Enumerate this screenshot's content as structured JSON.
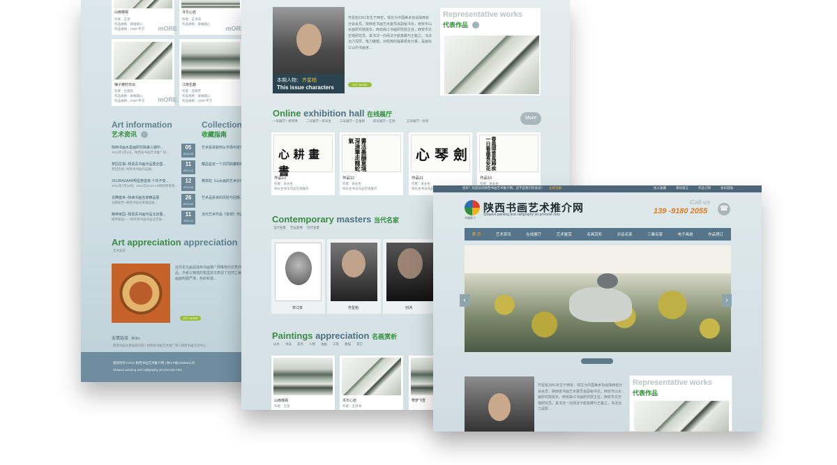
{
  "left_panel": {
    "thumbs": [
      {
        "title": "山雨楼阁",
        "line1": "作者：王觉",
        "line2": "作品规格：屏幅镜心",
        "line3": "作品规格：1000*平方"
      },
      {
        "title": "寻华心岩",
        "line1": "作者：王洪涛",
        "line2": "作品规格：屏幅镜心",
        "line3": "作品规格：1000*平方"
      },
      {
        "title": "梅子黄时日出",
        "line1": "作者：吕基智",
        "line2": "作品规格：屏幅镜心",
        "line3": "作品规格：1000*平方"
      },
      {
        "title": "江南生趣",
        "line1": "作者：吕晓芳",
        "line2": "作品规格：屏幅镜心",
        "line3": "作品规格：1000*平方"
      }
    ],
    "more_label": "mORE",
    "art_info": {
      "title_en": "Art information",
      "title_cn": "艺术资讯",
      "items": [
        {
          "text": "陕西书画水墨画研究院第三期中...",
          "sub": "2014年3月1日，陕西省书画艺术推广研...",
          "day": "05",
          "ym": "2014.03"
        },
        {
          "text": "梦回见相--杨贤青书画作品展全国...",
          "sub": "梦回见相--杨贤青书画作品展...",
          "day": "11",
          "ym": "2013.10"
        },
        {
          "text": "2012BAZAAR明星慈善夜 十年不变...",
          "sub": "2012年7月30日，2012年BAZAAR明星慈善夜...",
          "day": "12",
          "ym": "2012.06"
        },
        {
          "text": "龙腾盛世--陕西书画名家精品展",
          "sub": "龙腾盛世--陕西书画名家精品展...",
          "day": "26",
          "ym": "2012.02"
        },
        {
          "text": "精神家园--杨贤青书画作品北京展...",
          "sub": "精神家园——杨贤青书画作品北京展...",
          "day": "11",
          "ym": "2011.11"
        }
      ]
    },
    "collection": {
      "title_en": "Collection",
      "title_cn": "收藏指南",
      "items": [
        "艺术投资如何从市场中定位...",
        "藏品鉴定一个共同收藏和判断...",
        "黄宾虹《山水画的艺术价值》...",
        "艺术品投资的风险与回报...",
        "当代艺术作品《吉祥》作品赏析"
      ]
    },
    "art_app": {
      "title_en": "Art appreciation",
      "title_en2": "appreciation",
      "title_cn": "艺术鉴赏",
      "para": "这件花鸟画是陕西书画推广网推荐的优秀作品，作者以精湛的笔墨技法表现了自然之美，画面构图严谨，色彩和谐...",
      "btn": "GET MORE"
    },
    "links": {
      "title": "友情链接",
      "title_en": "links"
    },
    "footer_links": "陕西书画水墨画研究院 | 陕西省书画艺术推广网 | 陕西书画交流中心",
    "footer1": "版权所有©2013 陕西书画艺术推介网 | 陕ICP备10006011号",
    "footer2": "Shaanxi painting and calligraphy art promote nets"
  },
  "middle_panel": {
    "issue": {
      "label": "本期人物：",
      "name": "齐星柏",
      "en": "This issue characters",
      "btn": "GET MORE",
      "para": "齐星柏1951年生于西安，现在为中国美术协会陕西省分会会员，陕西省书画艺术委员会副秘书长，西安市山水画研究院院长，西安曲江书画研究院主任，西安市文史馆研究员。其书法一向师法于颜真卿与王羲之，书法功力深厚，笔力雄健。对经典的临摹极有分量，是画坛公认的书画家..."
    },
    "rep": {
      "title_en": "Representative works",
      "title_cn": "代表作品"
    },
    "online": {
      "title_en": "Online",
      "title_en2": "exhibition hall",
      "title_cn": "在线展厅",
      "tabs": [
        "一号展厅—杨贤青",
        "二号展厅—宋长生",
        "三号展厅—王金如",
        "四号展厅—王悦",
        "五号展厅—孙亮"
      ],
      "more": "More",
      "works": [
        {
          "title": "作品13",
          "author": "作者：宋长生",
          "desc": "宋长生书法作品在线展示"
        },
        {
          "title": "作品12",
          "author": "作者：宋长生",
          "desc": "宋长生书法作品在线展示"
        },
        {
          "title": "作品11",
          "author": "作者：宋长生",
          "desc": "宋长生书法作品在线展示"
        },
        {
          "title": "作品10",
          "author": "作者：宋长生",
          "desc": "宋长生书法作品在线展示"
        }
      ]
    },
    "masters": {
      "title_en": "Contemporary",
      "title_en2": "masters",
      "title_cn": "当代名家",
      "tabs": [
        "当代名家",
        "艺坛新秀",
        "历代名家"
      ],
      "people": [
        "宋江安",
        "齐星柏",
        "刘沐"
      ]
    },
    "paintings": {
      "title_en": "Paintings",
      "title_en2": "appreciation",
      "title_cn": "名画赏析",
      "tabs": [
        "山水",
        "书法",
        "花鸟",
        "人物",
        "油画",
        "工笔",
        "素描",
        "其它"
      ],
      "works": [
        {
          "title": "山雨楼阁",
          "author": "作者：王觉"
        },
        {
          "title": "寻华心岩",
          "author": "作者：王洪涛"
        },
        {
          "title": "寒梦飞雪",
          "author": "作者：吕基智"
        }
      ]
    }
  },
  "front_panel": {
    "topbar": {
      "welcome": "您好！欢迎访问陕西书画艺术推介网，还不是我们的会员？",
      "register": "立即注册",
      "links": [
        "加入收藏",
        "来访留言",
        "作品订购",
        "会员登陆"
      ]
    },
    "logo_cn": "陕西书画艺术推介网",
    "logo_en": "Shaanxi painting and calligraphy art promote nets",
    "logo_small": "书画推介",
    "call_label": "Call us",
    "phone": "139 -9180 2055",
    "nav": [
      "首 页",
      "艺术资讯",
      "在线展厅",
      "艺术鉴赏",
      "名画赏析",
      "对话名家",
      "三秦名家",
      "电子画册",
      "作品预订"
    ],
    "rep": {
      "title_en": "Representative works",
      "title_cn": "代表作品"
    },
    "intro": "齐星柏1951年生于西安，现在为中国美术协会陕西省分会会员，陕西省书画艺术委员会副秘书长，西安市山水画研究院院长，西安曲江书画研究院主任，西安市文史馆研究员。其书法一向师法于颜真卿与王羲之，书法功力深厚..."
  },
  "colors": {
    "accent_green": "#2f8f3a",
    "nav_blue": "#56748a",
    "bg_blue": "#cfdde3",
    "orange_phone": "#e07a1f"
  }
}
